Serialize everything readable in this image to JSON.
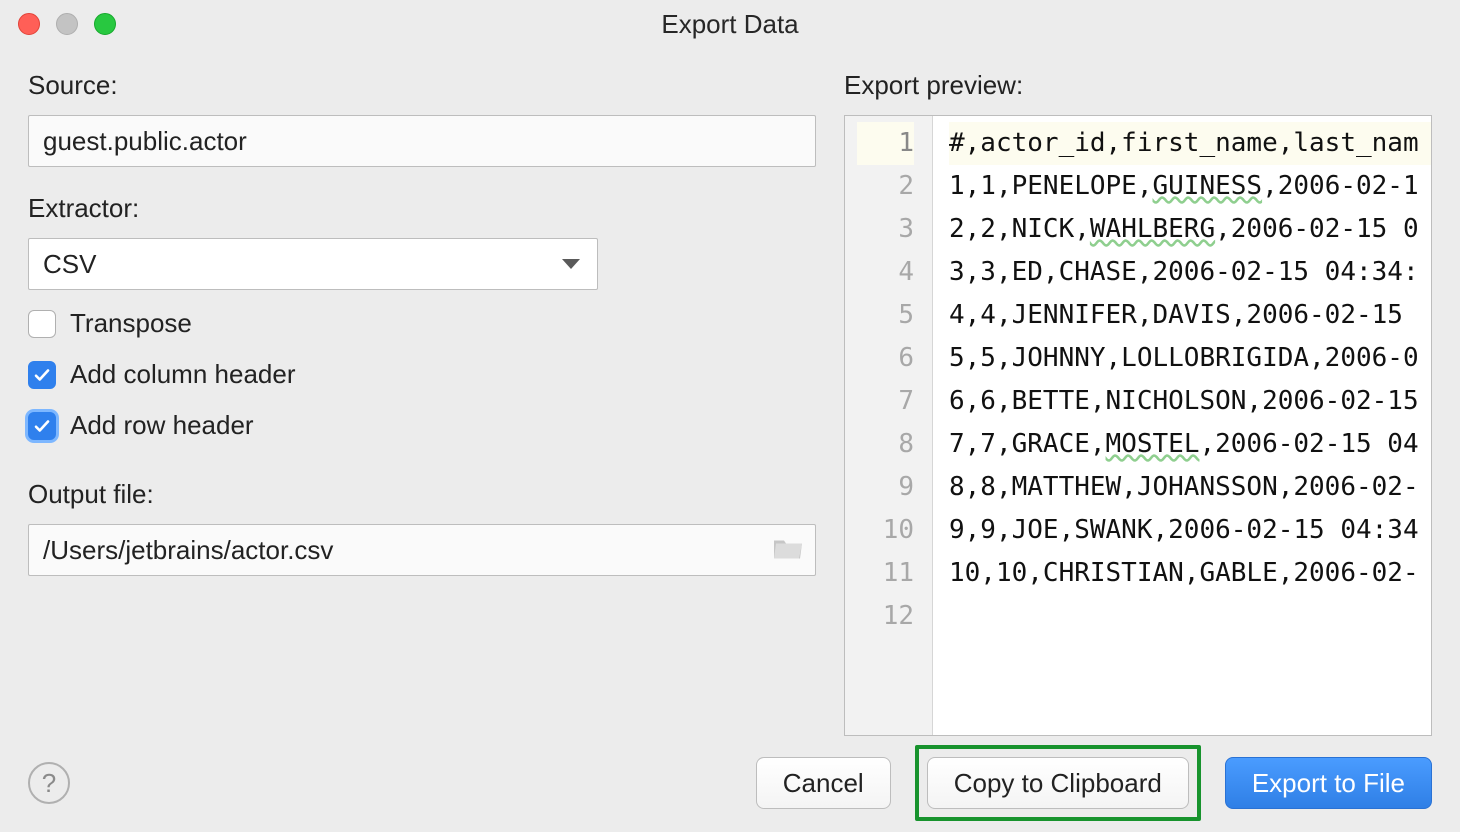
{
  "window": {
    "title": "Export Data"
  },
  "source": {
    "label": "Source:",
    "value": "guest.public.actor"
  },
  "extractor": {
    "label": "Extractor:",
    "value": "CSV"
  },
  "options": {
    "transpose_label": "Transpose",
    "add_column_header_label": "Add column header",
    "add_row_header_label": "Add row header",
    "transpose_checked": false,
    "add_column_header_checked": true,
    "add_row_header_checked": true
  },
  "output": {
    "label": "Output file:",
    "value": "/Users/jetbrains/actor.csv"
  },
  "preview": {
    "label": "Export preview:",
    "lines": [
      "#,actor_id,first_name,last_nam",
      "1,1,PENELOPE,GUINESS,2006-02-1",
      "2,2,NICK,WAHLBERG,2006-02-15 0",
      "3,3,ED,CHASE,2006-02-15 04:34:",
      "4,4,JENNIFER,DAVIS,2006-02-15 ",
      "5,5,JOHNNY,LOLLOBRIGIDA,2006-0",
      "6,6,BETTE,NICHOLSON,2006-02-15",
      "7,7,GRACE,MOSTEL,2006-02-15 04",
      "8,8,MATTHEW,JOHANSSON,2006-02-",
      "9,9,JOE,SWANK,2006-02-15 04:34",
      "10,10,CHRISTIAN,GABLE,2006-02-",
      ""
    ],
    "spellcheck_words": [
      "GUINESS",
      "WAHLBERG",
      "MOSTEL"
    ]
  },
  "footer": {
    "help": "?",
    "cancel": "Cancel",
    "copy": "Copy to Clipboard",
    "export": "Export to File"
  }
}
